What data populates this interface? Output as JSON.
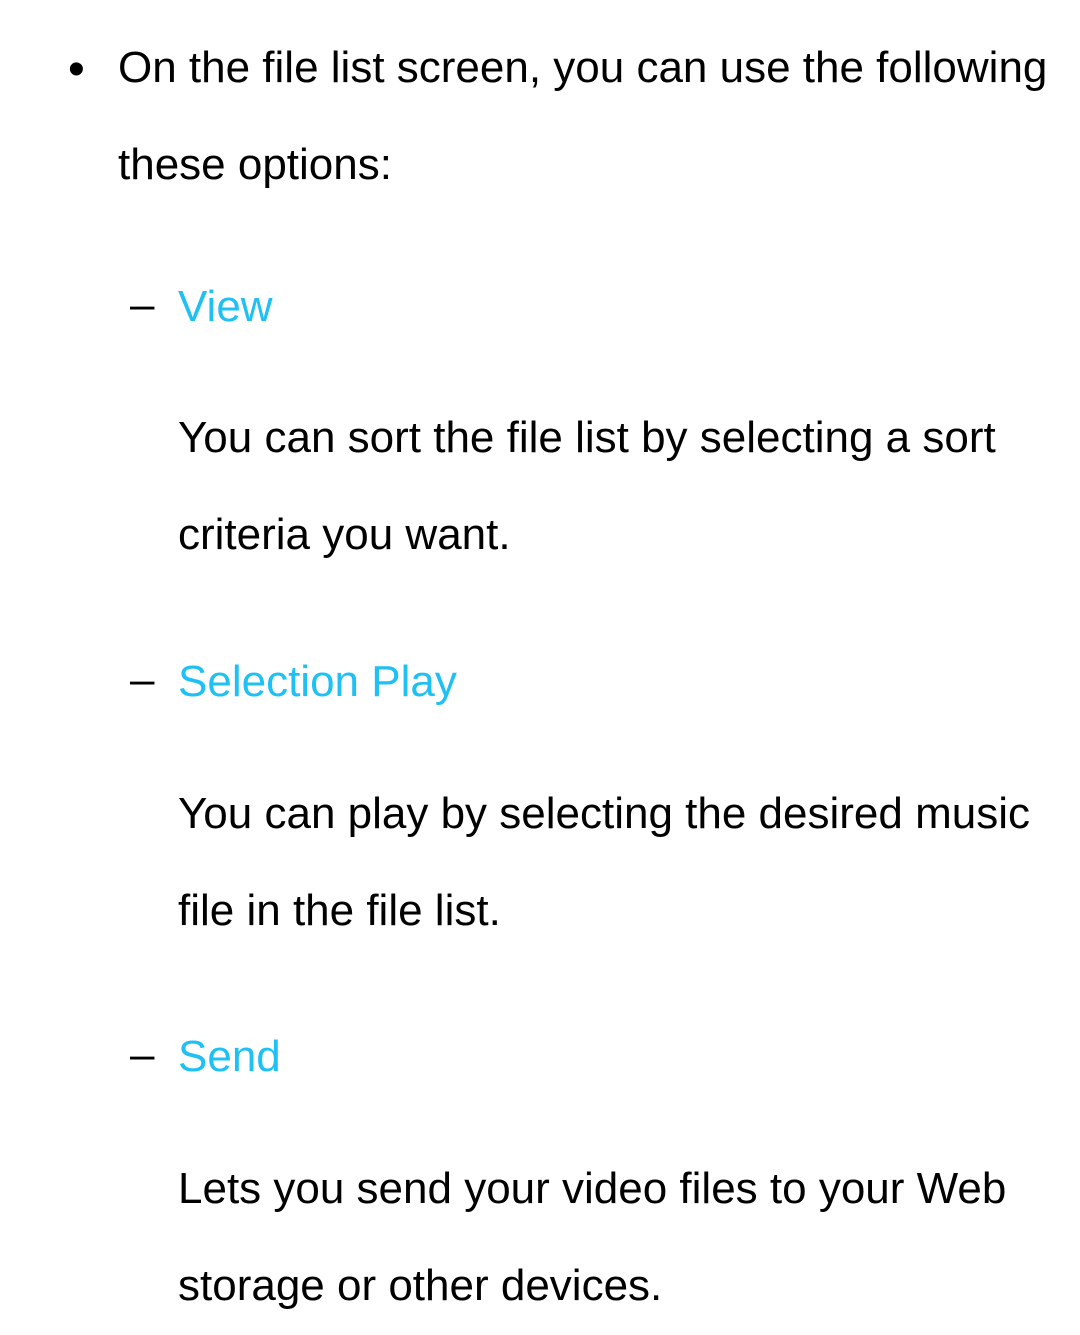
{
  "intro": "On the file list screen, you can use the following these options:",
  "options": [
    {
      "term": "View",
      "desc": "You can sort the file list by selecting a sort criteria you want."
    },
    {
      "term": "Selection Play",
      "desc": "You can play by selecting the desired music file in the file list."
    },
    {
      "term": "Send",
      "desc": "Lets you send your video files to your Web storage or other devices."
    }
  ]
}
